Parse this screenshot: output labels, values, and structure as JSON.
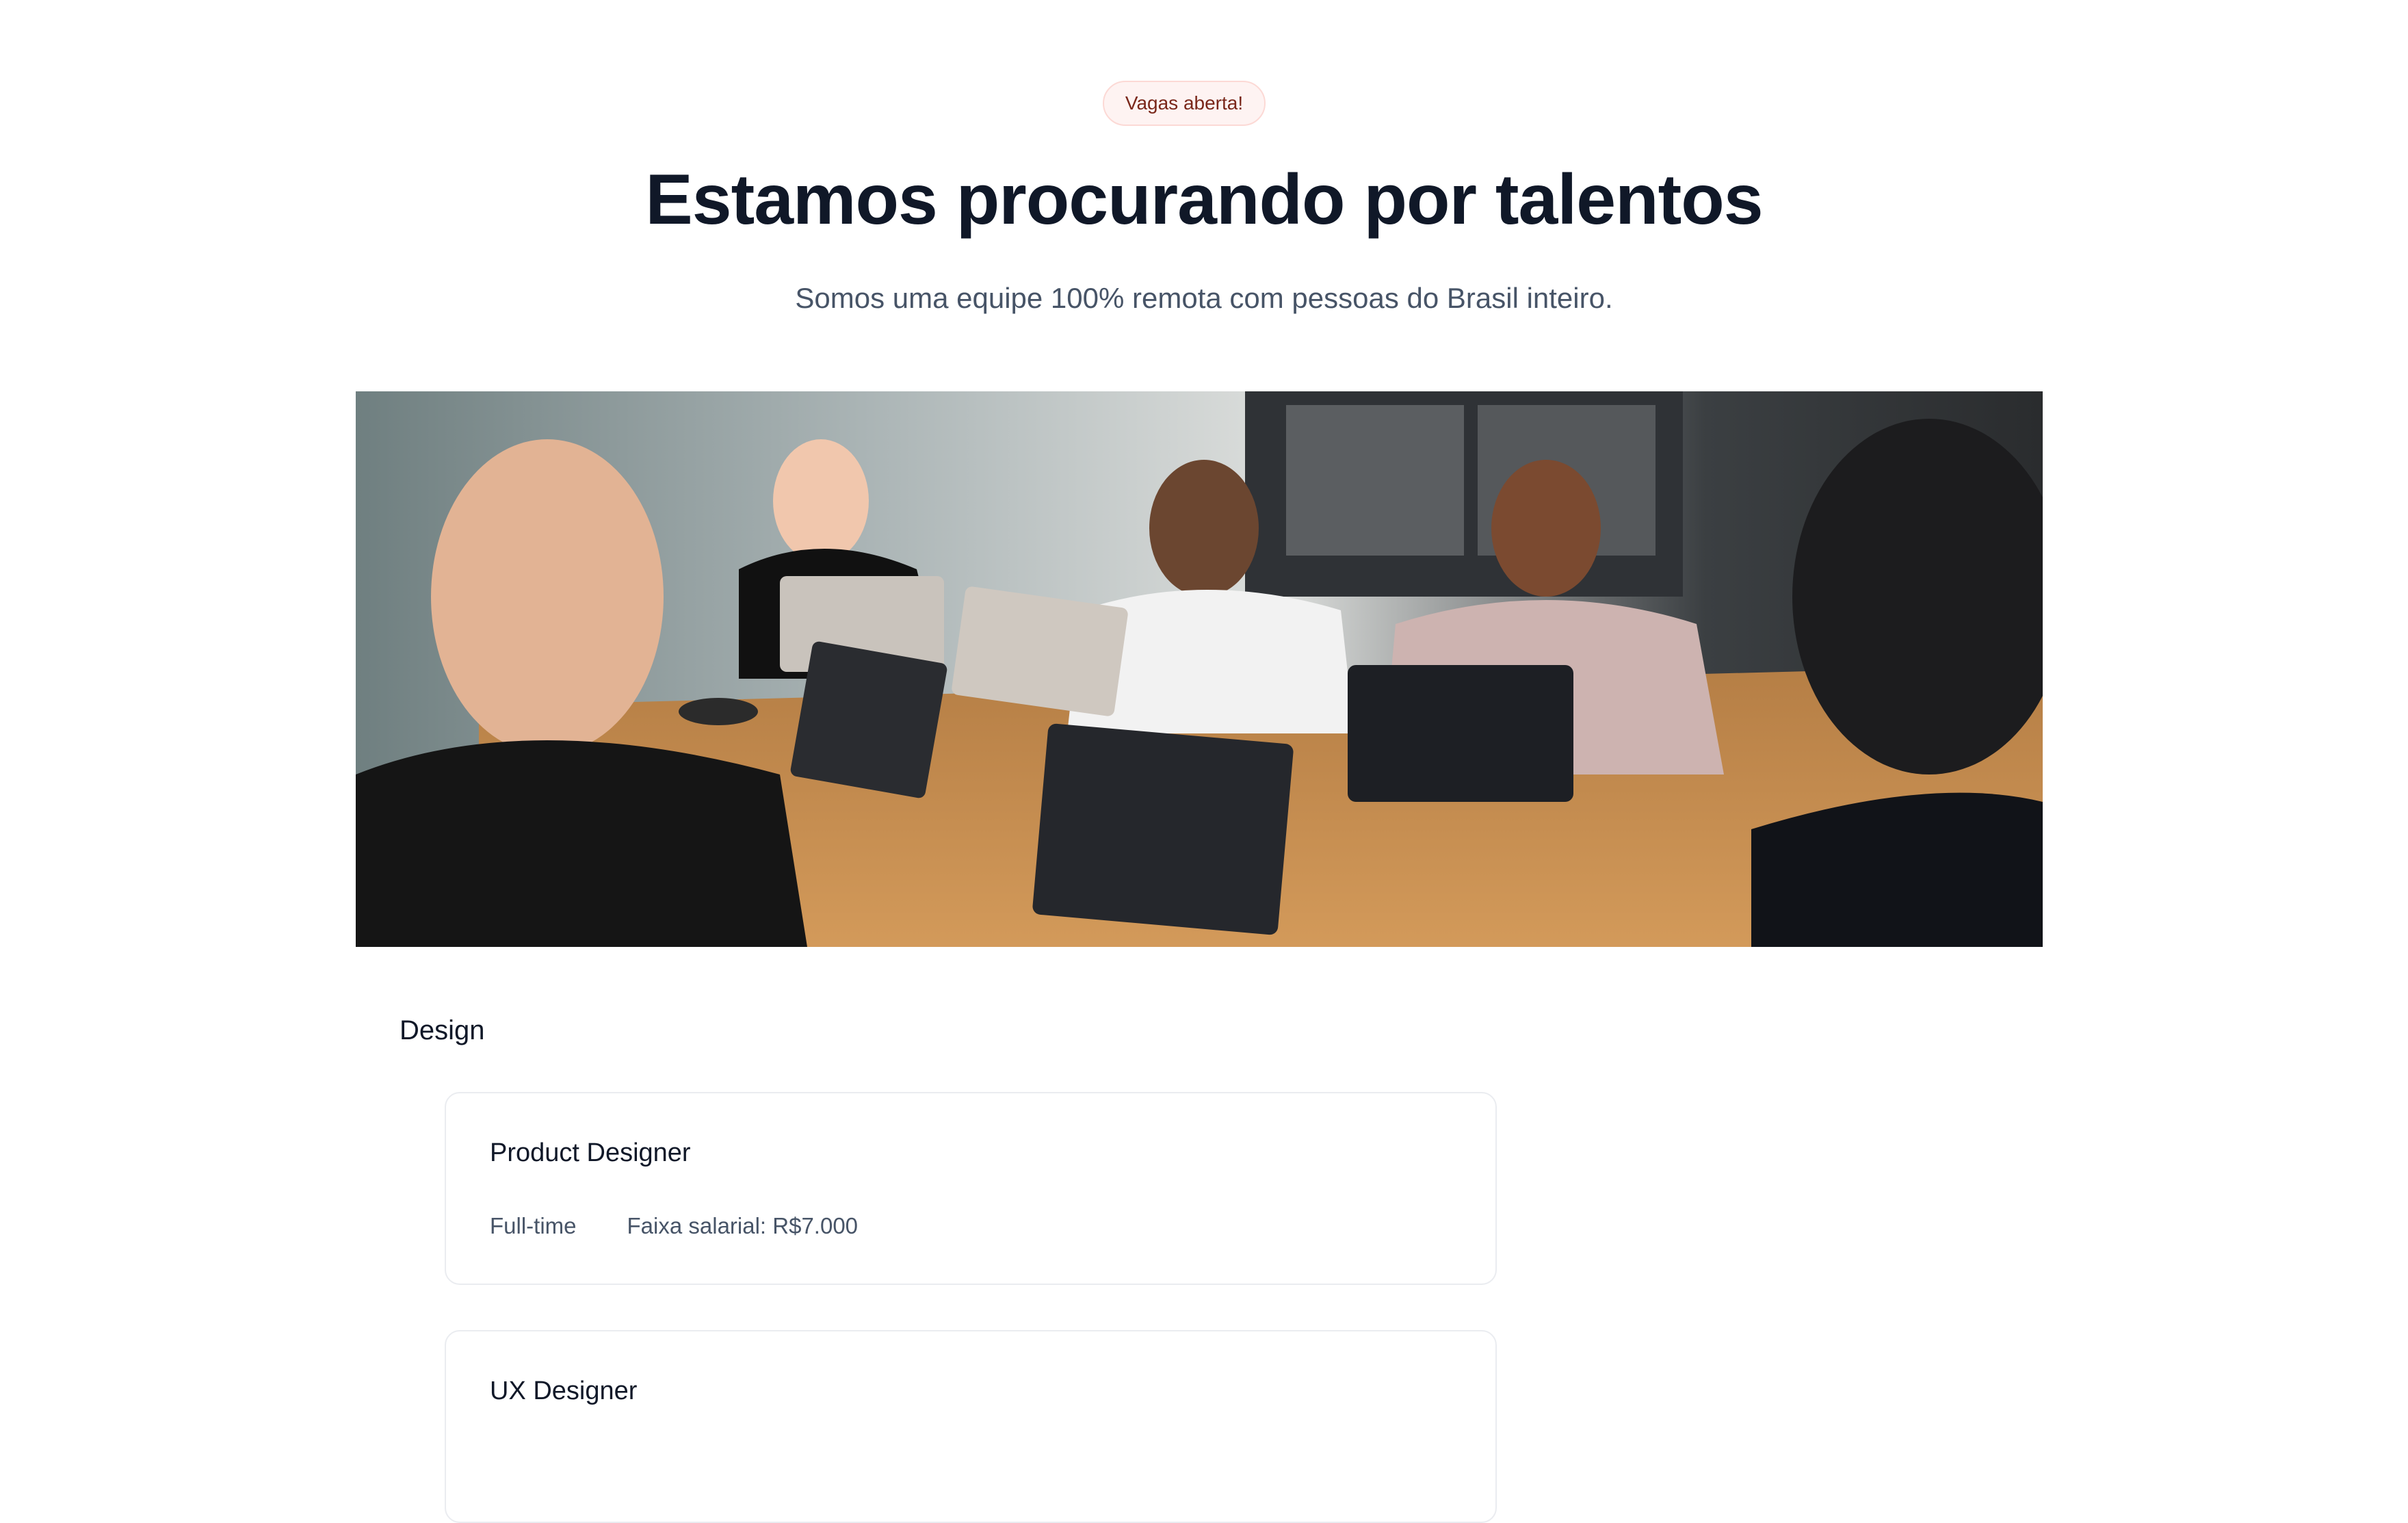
{
  "header": {
    "badge": "Vagas aberta!",
    "title": "Estamos procurando por talentos",
    "subtitle": "Somos uma equipe 100% remota com pessoas do Brasil inteiro."
  },
  "hero_image": {
    "description": "team-meeting-photo"
  },
  "sections": [
    {
      "title": "Design",
      "jobs": [
        {
          "title": "Product Designer",
          "type": "Full-time",
          "salary": "Faixa salarial: R$7.000"
        },
        {
          "title": "UX Designer",
          "type": "",
          "salary": ""
        }
      ]
    }
  ],
  "colors": {
    "badge_bg": "#fef3f2",
    "badge_text": "#7a271a",
    "heading": "#101828",
    "muted": "#475467",
    "card_border": "#eaecf0"
  }
}
